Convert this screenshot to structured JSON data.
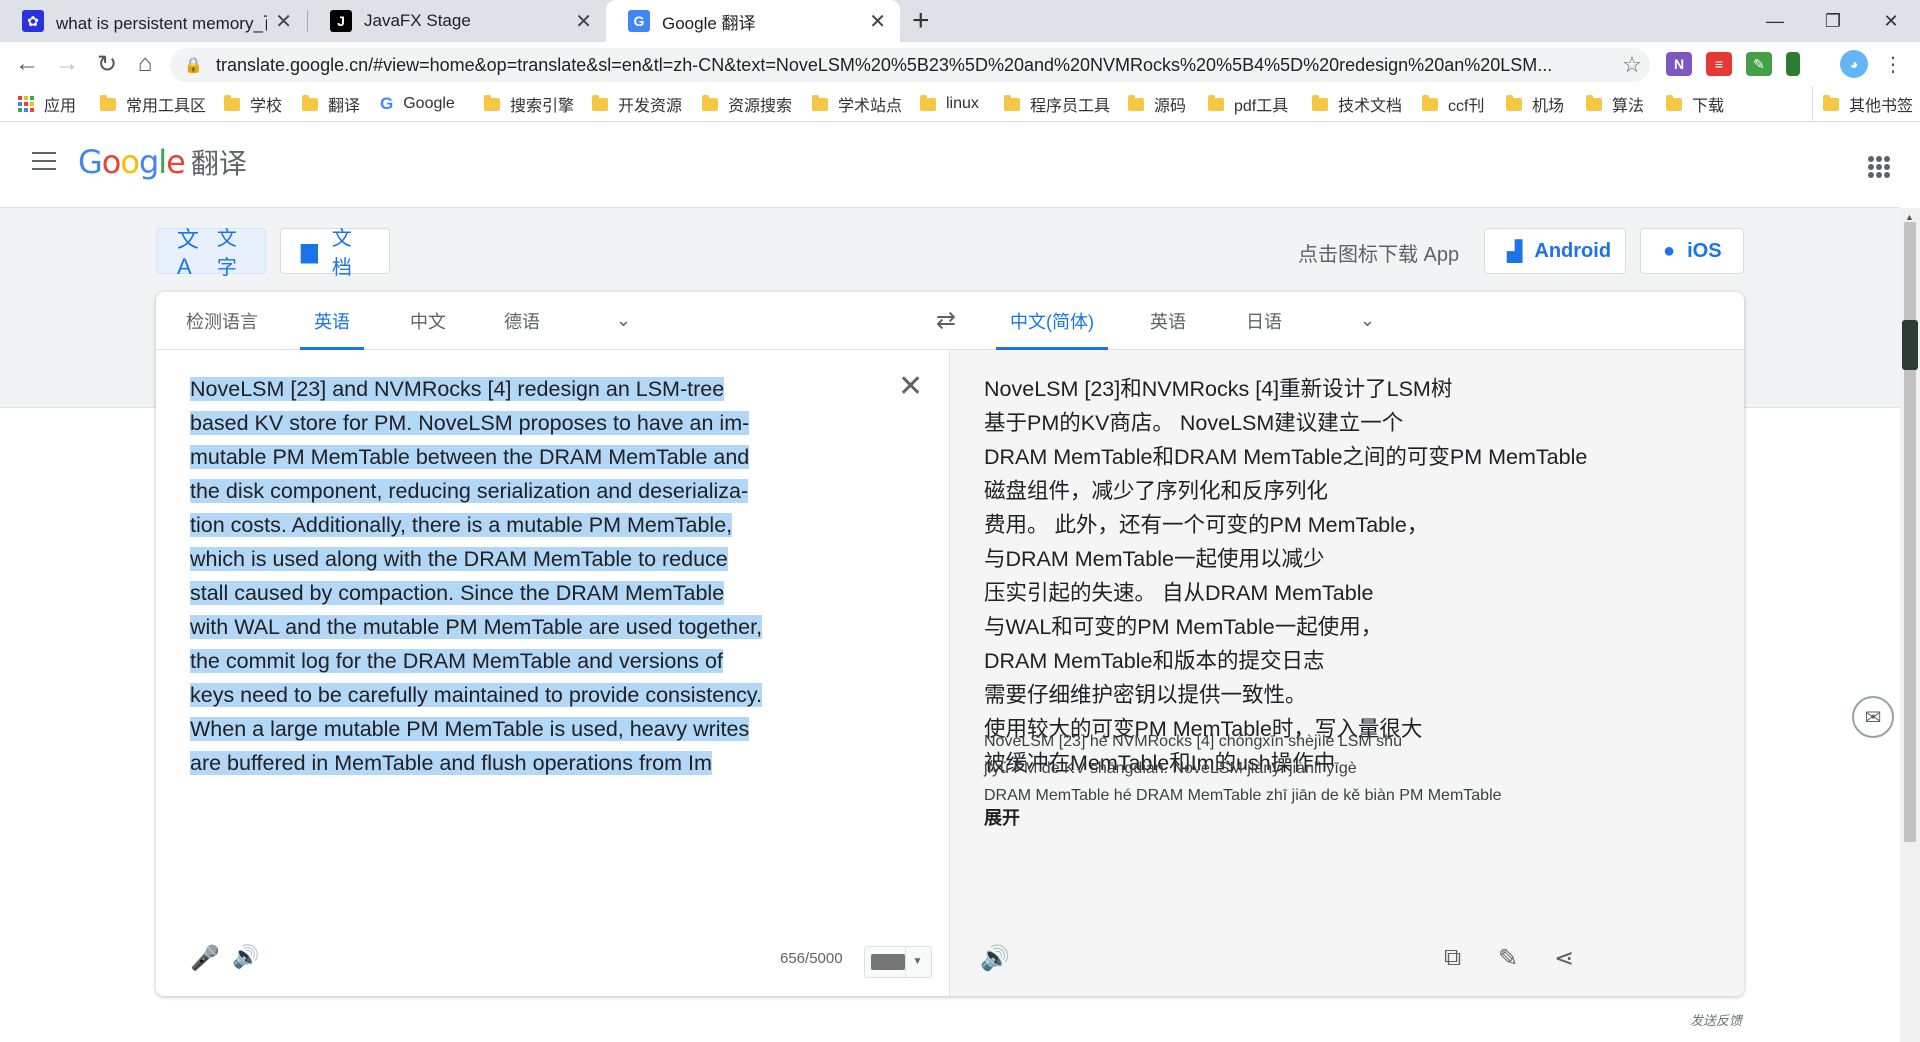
{
  "browser": {
    "tabs": [
      {
        "title": "what is persistent memory_百度",
        "favicon": "baidu-paw-icon",
        "active": false
      },
      {
        "title": "JavaFX Stage",
        "favicon": "jetbrains-j-icon",
        "active": false
      },
      {
        "title": "Google 翻译",
        "favicon": "google-translate-icon",
        "active": true
      }
    ],
    "url": "translate.google.cn/#view=home&op=translate&sl=en&tl=zh-CN&text=NoveLSM%20%5B23%5D%20and%20NVMRocks%20%5B4%5D%20redesign%20an%20LSM...",
    "bookmarks": [
      {
        "label": "应用",
        "icon": "apps-grid-icon"
      },
      {
        "label": "常用工具区",
        "icon": "folder-icon"
      },
      {
        "label": "学校",
        "icon": "folder-icon"
      },
      {
        "label": "翻译",
        "icon": "folder-icon"
      },
      {
        "label": "Google",
        "icon": "google-g-icon"
      },
      {
        "label": "搜索引擎",
        "icon": "folder-icon"
      },
      {
        "label": "开发资源",
        "icon": "folder-icon"
      },
      {
        "label": "资源搜索",
        "icon": "folder-icon"
      },
      {
        "label": "学术站点",
        "icon": "folder-icon"
      },
      {
        "label": "linux",
        "icon": "folder-icon"
      },
      {
        "label": "程序员工具",
        "icon": "folder-icon"
      },
      {
        "label": "源码",
        "icon": "folder-icon"
      },
      {
        "label": "pdf工具",
        "icon": "folder-icon"
      },
      {
        "label": "技术文档",
        "icon": "folder-icon"
      },
      {
        "label": "ccf刊",
        "icon": "folder-icon"
      },
      {
        "label": "机场",
        "icon": "folder-icon"
      },
      {
        "label": "算法",
        "icon": "folder-icon"
      },
      {
        "label": "下载",
        "icon": "folder-icon"
      }
    ],
    "other_bookmarks": "其他书签"
  },
  "translate": {
    "logo_google": "Google",
    "logo_suffix": "翻译",
    "modes": {
      "text": "文字",
      "document": "文档"
    },
    "download_app_text": "点击图标下载 App",
    "android": "Android",
    "ios": "iOS",
    "source_langs": [
      "检测语言",
      "英语",
      "中文",
      "德语"
    ],
    "source_active": "英语",
    "target_langs": [
      "中文(简体)",
      "英语",
      "日语"
    ],
    "target_active": "中文(简体)",
    "source_lines": [
      "NoveLSM [23] and NVMRocks [4] redesign an LSM-tree",
      "based KV store for PM. NoveLSM proposes to have an im-",
      "mutable PM MemTable between the DRAM MemTable and",
      "the disk component, reducing serialization and deserializa-",
      "tion costs. Additionally, there is a mutable PM MemTable,",
      "which is used along with the DRAM MemTable to reduce",
      "stall caused by compaction. Since the DRAM MemTable",
      "with WAL and the mutable PM MemTable are used together,",
      "the commit log for the DRAM MemTable and versions of",
      "keys need to be carefully maintained to provide consistency.",
      "When a large mutable PM MemTable is used, heavy writes",
      "are buffered in MemTable and flush operations from Im"
    ],
    "char_count": "656/5000",
    "target_lines": [
      "NoveLSM [23]和NVMRocks [4]重新设计了LSM树",
      "基于PM的KV商店。 NoveLSM建议建立一个",
      "DRAM MemTable和DRAM MemTable之间的可变PM MemTable",
      "磁盘组件，减少了序列化和反序列化",
      "费用。 此外，还有一个可变的PM MemTable，",
      "与DRAM MemTable一起使用以减少",
      "压实引起的失速。 自从DRAM MemTable",
      "与WAL和可变的PM MemTable一起使用，",
      "DRAM MemTable和版本的提交日志",
      "需要仔细维护密钥以提供一致性。",
      "使用较大的可变PM MemTable时，写入量很大",
      "被缓冲在MemTable和Im的ush操作中"
    ],
    "transliteration_lines": [
      "NoveLSM [23] hé NVMRocks [4] chóngxīn shèjìle LSM shù",
      "jīyú PM de KV shāngdiàn. NoveLSM jiànyì jiànlì yīgè",
      "DRAM MemTable hé DRAM MemTable zhī jiān de kě biàn PM MemTable"
    ],
    "expand": "展开",
    "feedback": "发送反馈"
  },
  "colors": {
    "accent": "#1a73e8",
    "selection": "#b3d7f7",
    "tabstrip": "#dee1e6"
  }
}
